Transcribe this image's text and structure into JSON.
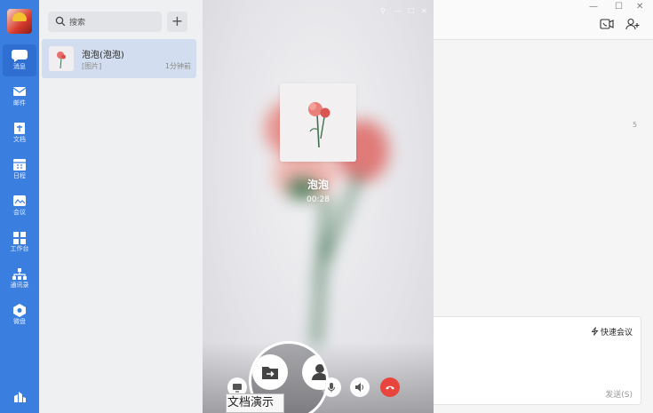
{
  "nav": {
    "items": [
      {
        "name": "message",
        "label": "消息",
        "icon": "chat-bubble-icon",
        "active": true
      },
      {
        "name": "mail",
        "label": "邮件",
        "icon": "mail-icon"
      },
      {
        "name": "docs",
        "label": "文档",
        "icon": "document-icon"
      },
      {
        "name": "calendar",
        "label": "日程",
        "icon": "calendar-icon"
      },
      {
        "name": "meeting",
        "label": "会议",
        "icon": "meeting-icon"
      },
      {
        "name": "workbench",
        "label": "工作台",
        "icon": "grid-icon"
      },
      {
        "name": "contacts",
        "label": "通讯录",
        "icon": "org-chart-icon"
      },
      {
        "name": "drive",
        "label": "微盘",
        "icon": "drive-icon"
      }
    ]
  },
  "list": {
    "search_placeholder": "搜索",
    "add_label": "+",
    "conversation": {
      "name": "泡泡(泡泡)",
      "preview": "[图片]",
      "time": "1分钟前"
    }
  },
  "call": {
    "callee": "泡泡",
    "duration": "00:28",
    "tooltip": "文档演示"
  },
  "chat": {
    "quick_meeting": "快速会议",
    "send": "发送(S)",
    "stray_char": "5"
  },
  "colors": {
    "rail": "#3a7ee0",
    "selected_conv": "#d2def0",
    "hangup": "#e8453c"
  }
}
